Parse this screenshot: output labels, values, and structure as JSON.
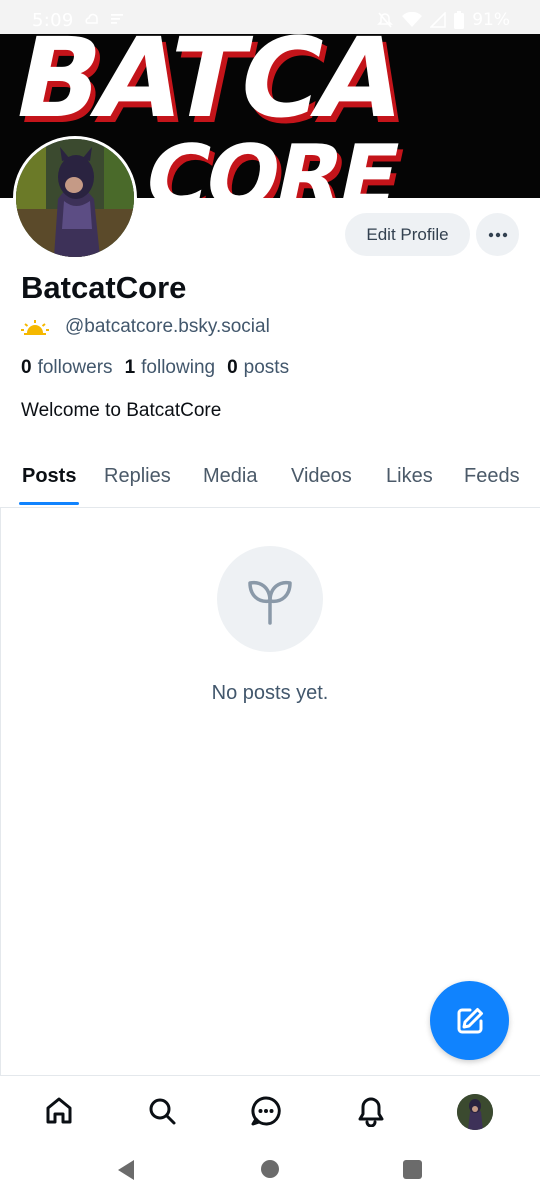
{
  "status_bar": {
    "time": "5:09",
    "battery": "91%"
  },
  "banner": {
    "text_line1": "BATCA",
    "text_line2": "CORE"
  },
  "profile": {
    "display_name": "BatcatCore",
    "handle": "@batcatcore.bsky.social",
    "followers_count": "0",
    "followers_label": "followers",
    "following_count": "1",
    "following_label": "following",
    "posts_count": "0",
    "posts_label": "posts",
    "bio": "Welcome to BatcatCore",
    "edit_button_label": "Edit Profile"
  },
  "tabs": [
    {
      "label": "Posts"
    },
    {
      "label": "Replies"
    },
    {
      "label": "Media"
    },
    {
      "label": "Videos"
    },
    {
      "label": "Likes"
    },
    {
      "label": "Feeds"
    }
  ],
  "empty_state": {
    "message": "No posts yet.",
    "icon": "seedling-icon"
  },
  "colors": {
    "accent": "#1083fe",
    "muted_text": "#42576c",
    "button_bg": "#eef1f4"
  },
  "bottom_nav": {
    "items": [
      "home-icon",
      "search-icon",
      "chat-icon",
      "bell-icon",
      "profile-avatar"
    ]
  }
}
